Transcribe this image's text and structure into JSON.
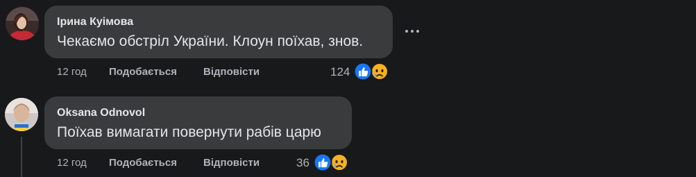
{
  "comments": [
    {
      "author": "Ірина Куімова",
      "text": "Чекаємо обстріл України. Клоун поїхав, знов.",
      "time": "12 год",
      "like_label": "Подобається",
      "reply_label": "Відповісти",
      "reaction_count": "124",
      "reactions": [
        "like-icon",
        "sad-icon"
      ]
    },
    {
      "author": "Oksana Odnovol",
      "text": "Поїхав вимагати повернути рабів царю",
      "time": "12 год",
      "like_label": "Подобається",
      "reply_label": "Відповісти",
      "reaction_count": "36",
      "reactions": [
        "like-icon",
        "sad-icon"
      ]
    }
  ],
  "colors": {
    "background": "#18191a",
    "bubble": "#3a3b3c",
    "primary_text": "#e4e6eb",
    "secondary_text": "#b0b3b8",
    "like_blue": "#1877f2",
    "sad_yellow": "#f7b125"
  }
}
